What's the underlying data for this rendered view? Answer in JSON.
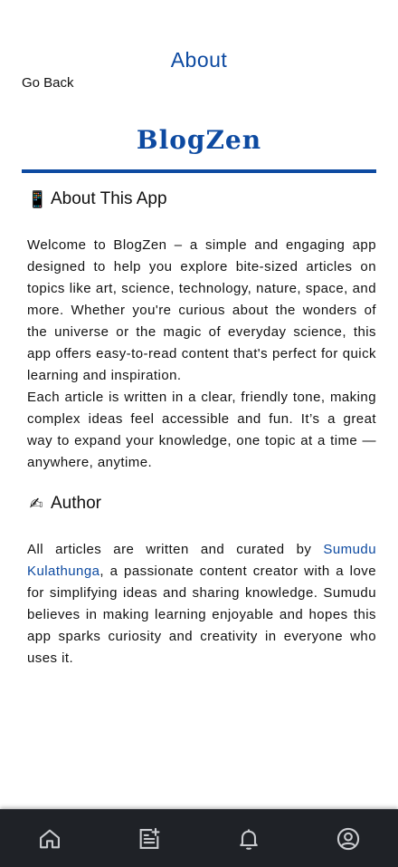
{
  "header": {
    "title": "About",
    "back_label": "Go Back"
  },
  "brand": {
    "name": "BlogZen",
    "color": "#0d4aa1"
  },
  "about_section": {
    "emoji": "📱",
    "heading": "About This App",
    "paragraph_1": "Welcome to BlogZen – a simple and engaging app designed to help you explore bite-sized articles on topics like art, science, technology, nature, space, and more. Whether you're curious about the wonders of the universe or the magic of everyday science, this app offers easy-to-read content that's perfect for quick learning and inspiration.",
    "paragraph_2": "Each article is written in a clear, friendly tone, making complex ideas feel accessible and fun. It’s a great way to expand your knowledge, one topic at a time — anywhere, anytime."
  },
  "author_section": {
    "emoji": "✍",
    "heading": "Author",
    "text_before": "All articles are written and curated by ",
    "author_name": "Sumudu Kulathunga",
    "text_after": ", a passionate content creator with a love for simplifying ideas and sharing knowledge. Sumudu believes in making learning enjoyable and hopes this app sparks curiosity and creativity in everyone who uses it."
  },
  "bottom_nav": {
    "background": "#1f2227",
    "icon_color": "#c9cbcf",
    "items": [
      {
        "icon": "home-icon"
      },
      {
        "icon": "new-post-icon"
      },
      {
        "icon": "notifications-icon"
      },
      {
        "icon": "profile-icon"
      }
    ]
  }
}
